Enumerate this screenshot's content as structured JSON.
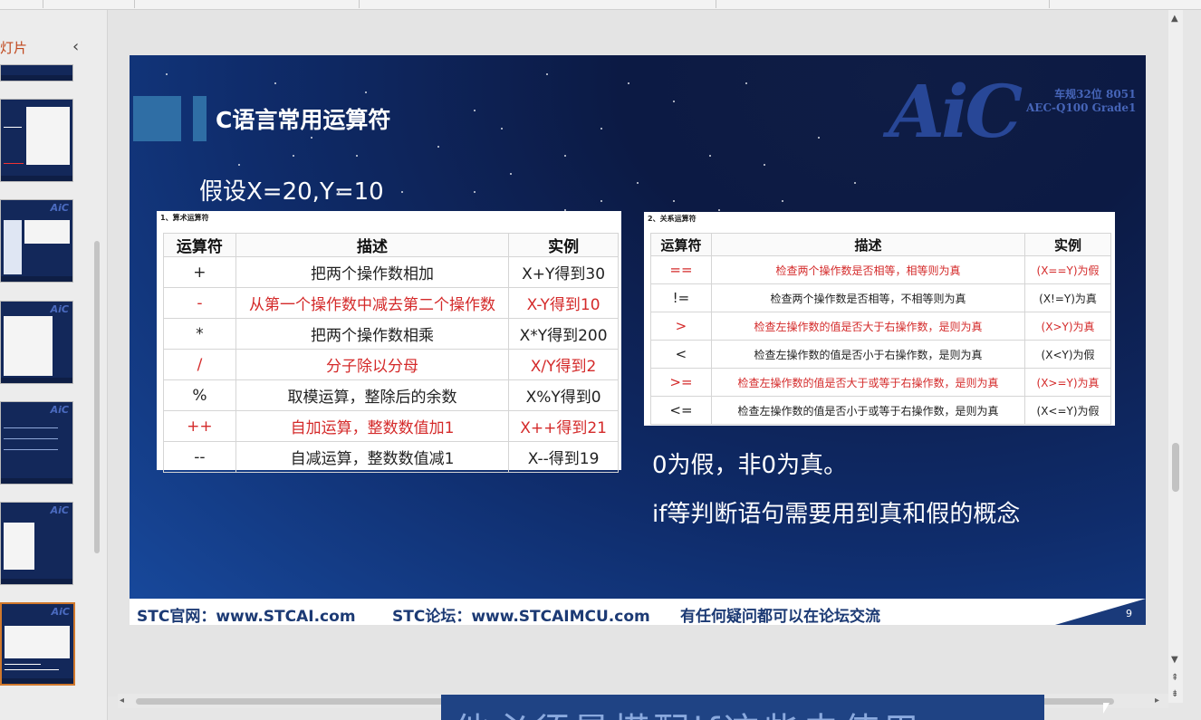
{
  "pane": {
    "title": "灯片",
    "collapse_icon": "‹"
  },
  "slide": {
    "title": "C语言常用运算符",
    "assumption": "假设X=20,Y=10",
    "logo": {
      "text": "AiC",
      "sub1": "车规32位 8051",
      "sub2": "AEC-Q100 Grade1"
    },
    "table1": {
      "caption": "1、算术运算符",
      "headers": [
        "运算符",
        "描述",
        "实例"
      ],
      "rows": [
        {
          "op": "+",
          "desc": "把两个操作数相加",
          "ex": "X+Y得到30",
          "red": false
        },
        {
          "op": "-",
          "desc": "从第一个操作数中减去第二个操作数",
          "ex": "X-Y得到10",
          "red": true
        },
        {
          "op": "*",
          "desc": "把两个操作数相乘",
          "ex": "X*Y得到200",
          "red": false
        },
        {
          "op": "/",
          "desc": "分子除以分母",
          "ex": "X/Y得到2",
          "red": true
        },
        {
          "op": "%",
          "desc": "取模运算，整除后的余数",
          "ex": "X%Y得到0",
          "red": false
        },
        {
          "op": "++",
          "desc": "自加运算，整数数值加1",
          "ex": "X++得到21",
          "red": true
        },
        {
          "op": "--",
          "desc": "自减运算，整数数值减1",
          "ex": "X--得到19",
          "red": false
        }
      ]
    },
    "table2": {
      "caption": "2、关系运算符",
      "headers": [
        "运算符",
        "描述",
        "实例"
      ],
      "rows": [
        {
          "op": "==",
          "desc": "检查两个操作数是否相等，相等则为真",
          "ex": "(X==Y)为假",
          "red": true
        },
        {
          "op": "!=",
          "desc": "检查两个操作数是否相等，不相等则为真",
          "ex": "(X!=Y)为真",
          "red": false
        },
        {
          "op": ">",
          "desc": "检查左操作数的值是否大于右操作数，是则为真",
          "ex": "(X>Y)为真",
          "red": true
        },
        {
          "op": "<",
          "desc": "检查左操作数的值是否小于右操作数，是则为真",
          "ex": "(X<Y)为假",
          "red": false
        },
        {
          "op": ">=",
          "desc": "检查左操作数的值是否大于或等于右操作数，是则为真",
          "ex": "(X>=Y)为真",
          "red": true
        },
        {
          "op": "<=",
          "desc": "检查左操作数的值是否小于或等于右操作数，是则为真",
          "ex": "(X<=Y)为假",
          "red": false
        }
      ]
    },
    "note1": "0为假，非0为真。",
    "note2": "if等判断语句需要用到真和假的概念",
    "footer": {
      "site": "STC官网：www.STCAI.com",
      "forum": "STC论坛：www.STCAIMCU.com",
      "tip": "有任何疑问都可以在论坛交流",
      "page": "9"
    }
  },
  "subtitle": "他必须是搭配if这些去使用",
  "colors": {
    "accent_red": "#d42a2a",
    "slide_blue": "#0f2c6b",
    "footer_text": "#1c3a74",
    "thumb_active": "#d0782c"
  }
}
